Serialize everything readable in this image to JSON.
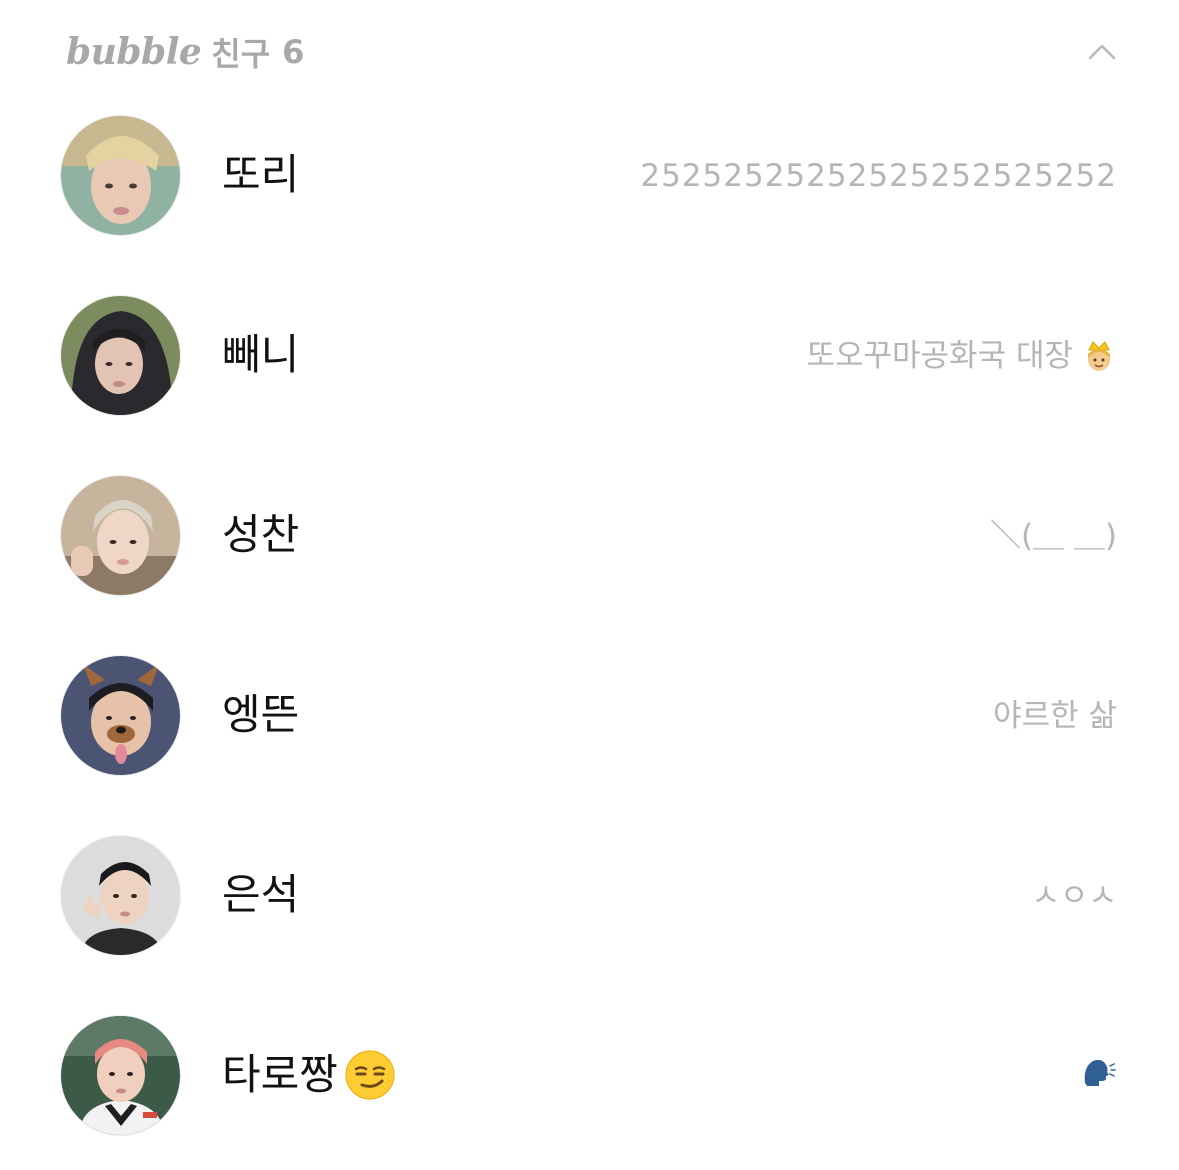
{
  "header": {
    "brand": "bubble",
    "title": "친구",
    "count": "6"
  },
  "friends": [
    {
      "name": "또리",
      "status": "25252525252525252525252",
      "avatar_color": "#8aa79a"
    },
    {
      "name": "빼니",
      "status": "또오꾸마공화국 대장",
      "status_icon": "prince-emoji",
      "avatar_color": "#5c6b4c"
    },
    {
      "name": "성찬",
      "status": "＼(＿ ＿)",
      "avatar_color": "#b9a98e"
    },
    {
      "name": "엥뜬",
      "status": "야르한 삶",
      "avatar_color": "#4a4f6a"
    },
    {
      "name": "은석",
      "status": "ㅅㅇㅅ",
      "avatar_color": "#d9d9d9"
    },
    {
      "name": "타로짱",
      "name_icon": "smirk-emoji",
      "status": "",
      "status_icon": "speaking-head-emoji",
      "avatar_color": "#2f4a3a"
    }
  ]
}
